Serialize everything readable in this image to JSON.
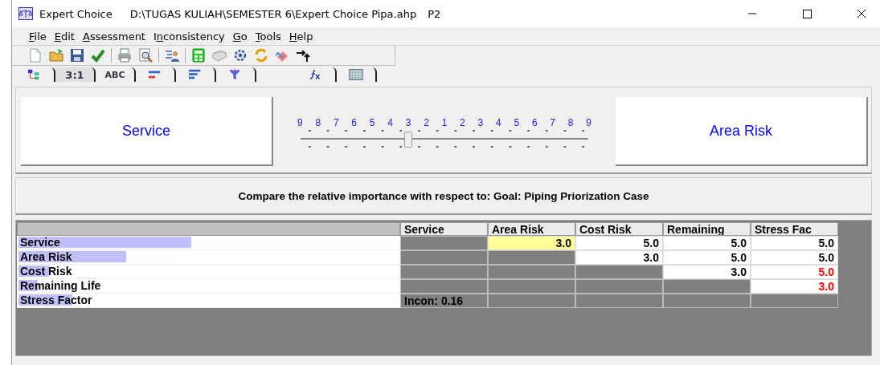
{
  "window": {
    "app": "Expert Choice",
    "path": "D:\\TUGAS KULIAH\\SEMESTER 6\\Expert Choice Pipa.ahp",
    "node": "P2"
  },
  "menu": [
    {
      "key": "F",
      "rest": "ile"
    },
    {
      "key": "E",
      "rest": "dit"
    },
    {
      "key": "A",
      "rest": "ssessment"
    },
    {
      "pre": "I",
      "key": "n",
      "rest": "consistency"
    },
    {
      "key": "G",
      "rest": "o"
    },
    {
      "key": "T",
      "rest": "ools"
    },
    {
      "key": "H",
      "rest": "elp"
    }
  ],
  "tabs": [
    {
      "kind": "icon",
      "selected": false
    },
    {
      "kind": "text",
      "label": "3:1",
      "selected": true
    },
    {
      "kind": "text",
      "label": "ABC",
      "selected": false
    },
    {
      "kind": "icon",
      "selected": false
    },
    {
      "kind": "icon",
      "selected": false
    },
    {
      "kind": "icon",
      "selected": false
    },
    {
      "kind": "icon",
      "selected": false
    },
    {
      "kind": "icon",
      "selected": false
    }
  ],
  "comparison": {
    "left": "Service",
    "right": "Area Risk",
    "scale": [
      "9",
      "8",
      "7",
      "6",
      "5",
      "4",
      "3",
      "2",
      "1",
      "2",
      "3",
      "4",
      "5",
      "6",
      "7",
      "8",
      "9"
    ],
    "slider": {
      "level": 0.375
    },
    "prompt": "Compare the relative importance with respect to: Goal: Piping Priorization Case"
  },
  "matrix": {
    "columns": [
      "Service",
      "Area Risk",
      "Cost Risk",
      "Remaining",
      "Stress Fac"
    ],
    "rows": [
      {
        "name": "Service",
        "level": 0.45,
        "cells": [
          {
            "kind": "blank"
          },
          {
            "kind": "value",
            "text": "3.0",
            "selected": true,
            "flagged": false
          },
          {
            "kind": "value",
            "text": "5.0",
            "selected": false,
            "flagged": false
          },
          {
            "kind": "value",
            "text": "5.0",
            "selected": false,
            "flagged": false
          },
          {
            "kind": "value",
            "text": "5.0",
            "selected": false,
            "flagged": false
          }
        ]
      },
      {
        "name": "Area Risk",
        "level": 0.28,
        "cells": [
          {
            "kind": "blank"
          },
          {
            "kind": "blank"
          },
          {
            "kind": "value",
            "text": "3.0",
            "selected": false,
            "flagged": false
          },
          {
            "kind": "value",
            "text": "5.0",
            "selected": false,
            "flagged": false
          },
          {
            "kind": "value",
            "text": "5.0",
            "selected": false,
            "flagged": false
          }
        ]
      },
      {
        "name": "Cost Risk",
        "level": 0.08,
        "cells": [
          {
            "kind": "blank"
          },
          {
            "kind": "blank"
          },
          {
            "kind": "blank"
          },
          {
            "kind": "value",
            "text": "3.0",
            "selected": false,
            "flagged": false
          },
          {
            "kind": "value",
            "text": "5.0",
            "selected": false,
            "flagged": true
          }
        ]
      },
      {
        "name": "Remaining Life",
        "level": 0.05,
        "cells": [
          {
            "kind": "blank"
          },
          {
            "kind": "blank"
          },
          {
            "kind": "blank"
          },
          {
            "kind": "blank"
          },
          {
            "kind": "value",
            "text": "3.0",
            "selected": false,
            "flagged": true
          }
        ]
      },
      {
        "name": "Stress Factor",
        "level": 0.14,
        "cells": [
          {
            "kind": "note",
            "text": "Incon: 0.16"
          },
          {
            "kind": "blank"
          },
          {
            "kind": "blank"
          },
          {
            "kind": "blank"
          },
          {
            "kind": "blank"
          }
        ]
      }
    ]
  }
}
